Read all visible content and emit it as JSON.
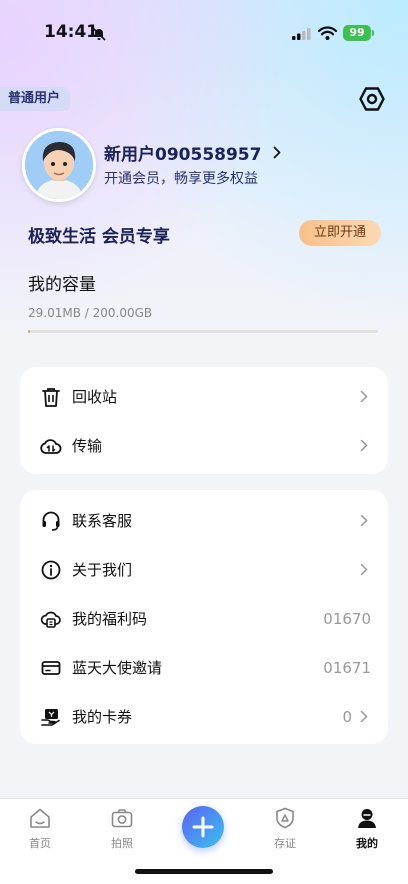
{
  "status_bar": {
    "time": "14:41",
    "battery": "99"
  },
  "profile": {
    "badge": "普通用户",
    "username": "新用户090558957",
    "promo": "开通会员，畅享更多权益"
  },
  "vip": {
    "title": "极致生活  会员专享",
    "button": "立即开通"
  },
  "capacity": {
    "title": "我的容量",
    "used_text": "29.01MB / 200.00GB",
    "used_fraction": 0.0001
  },
  "card1": [
    {
      "label": "回收站",
      "icon": "trash-icon"
    },
    {
      "label": "传输",
      "icon": "cloud-transfer-icon"
    }
  ],
  "card2": [
    {
      "label": "联系客服",
      "icon": "headset-icon",
      "value": ""
    },
    {
      "label": "关于我们",
      "icon": "info-icon",
      "value": ""
    },
    {
      "label": "我的福利码",
      "icon": "gift-code-icon",
      "value": "01670"
    },
    {
      "label": "蓝天大使邀请",
      "icon": "card-icon",
      "value": "01671"
    },
    {
      "label": "我的卡券",
      "icon": "coupon-icon",
      "value": "0"
    }
  ],
  "tabs": [
    {
      "label": "首页",
      "icon": "home-icon"
    },
    {
      "label": "拍照",
      "icon": "camera-icon"
    },
    {
      "label": "",
      "icon": "plus-icon"
    },
    {
      "label": "存证",
      "icon": "shield-icon"
    },
    {
      "label": "我的",
      "icon": "person-icon"
    }
  ]
}
